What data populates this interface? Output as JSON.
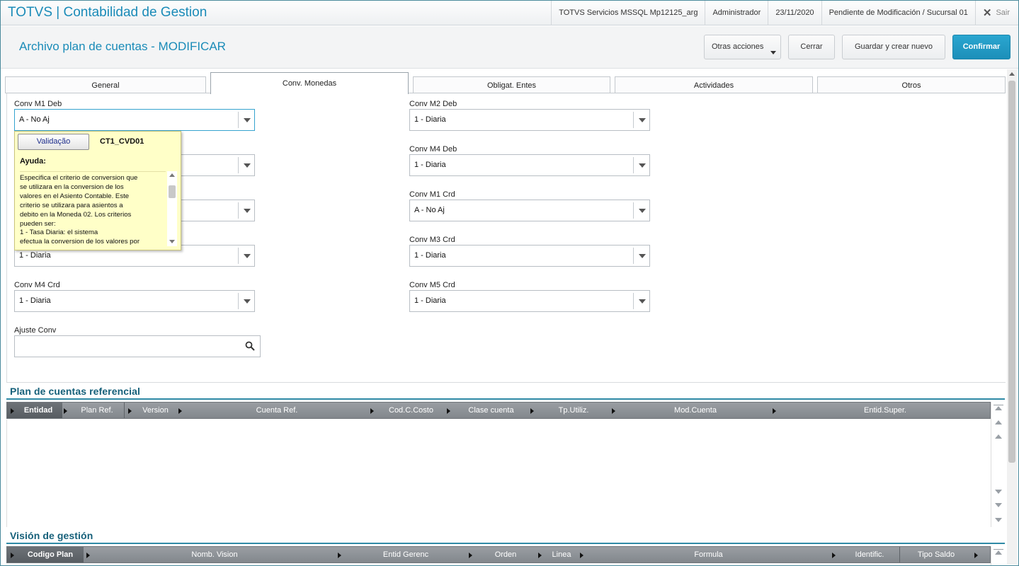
{
  "app": {
    "title": "TOTVS | Contabilidad de Gestion",
    "server": "TOTVS Servicios MSSQL Mp12125_arg",
    "user": "Administrador",
    "date": "23/11/2020",
    "status": "Pendiente de Modificación / Sucursal 01",
    "exit_label": "Sair"
  },
  "header": {
    "page_title": "Archivo plan de cuentas - MODIFICAR",
    "otras_label": "Otras acciones",
    "cerrar_label": "Cerrar",
    "guardar_label": "Guardar y crear nuevo",
    "confirmar_label": "Confirmar",
    "accent_color": "#1a8bb8",
    "confirm_color": "#1c8fb9"
  },
  "tabs": [
    {
      "label": "General",
      "active": false
    },
    {
      "label": "Conv. Monedas",
      "active": true
    },
    {
      "label": "Obligat. Entes",
      "active": false
    },
    {
      "label": "Actividades",
      "active": false
    },
    {
      "label": "Otros",
      "active": false
    }
  ],
  "form": {
    "left": [
      {
        "label": "Conv M1  Deb",
        "value": "A - No Aj"
      },
      {
        "label": "",
        "value": ""
      },
      {
        "label": "",
        "value": ""
      },
      {
        "label": "",
        "value": "1 - Diaria"
      },
      {
        "label": "Conv M4 Crd",
        "value": "1 - Diaria"
      }
    ],
    "right": [
      {
        "label": "Conv M2 Deb",
        "value": "1 - Diaria"
      },
      {
        "label": "Conv M4 Deb",
        "value": "1 - Diaria"
      },
      {
        "label": "Conv M1 Crd",
        "value": "A - No Aj"
      },
      {
        "label": "Conv M3 Crd",
        "value": "1 - Diaria"
      },
      {
        "label": "Conv M5 Crd",
        "value": "1 - Diaria"
      }
    ],
    "ajuste": {
      "label": "Ajuste Conv",
      "value": ""
    }
  },
  "help": {
    "button_label": "Validação",
    "code": "CT1_CVD01",
    "title": "Ayuda:",
    "lines": [
      "Especifica el criterio de conversion que",
      "se utilizara en la conversion de los",
      "valores en el Asiento Contable. Este",
      "criterio se utilizara para asientos a",
      "debito en la Moneda 02. Los criterios",
      "pueden ser:",
      "1 - Tasa Diaria: el sistema",
      "efectua la conversion de los valores por"
    ]
  },
  "plan_referencial": {
    "title": "Plan de cuentas referencial",
    "columns": [
      "Entidad",
      "Plan Ref.",
      "Version",
      "Cuenta Ref.",
      "Cod.C.Costo",
      "Clase cuenta",
      "Tp.Utiliz.",
      "Mod.Cuenta",
      "Entid.Super."
    ]
  },
  "vision_gestion": {
    "title": "Visión de gestión",
    "columns": [
      "Codigo Plan",
      "Nomb. Vision",
      "Entid Gerenc",
      "Orden",
      "Linea",
      "Formula",
      "Identific.",
      "Tipo Saldo"
    ]
  }
}
